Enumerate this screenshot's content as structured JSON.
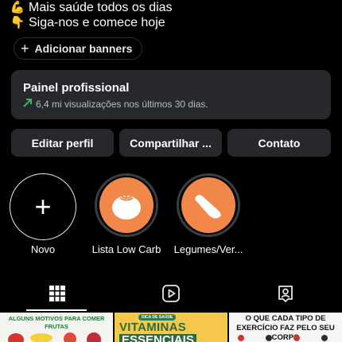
{
  "bio": {
    "line1": {
      "icon": "flexed-biceps-icon",
      "text": "Mais saúde todos os dias"
    },
    "line2": {
      "icon": "pointing-down-icon",
      "text": "Siga-nos e comece hoje"
    }
  },
  "add_banners": {
    "icon": "plus-icon",
    "label": "Adicionar banners"
  },
  "pro_panel": {
    "title": "Painel profissional",
    "trend_icon": "trending-up-arrow-icon",
    "subtitle": "6,4 mi visualizações nos últimos 30 dias."
  },
  "profile_buttons": {
    "edit": "Editar perfil",
    "share": "Compartilhar ...",
    "contact": "Contato"
  },
  "highlights": [
    {
      "label": "Novo",
      "icon": "plus-icon"
    },
    {
      "label": "Lista Low Carb",
      "icon": "tomato-icon"
    },
    {
      "label": "Legumes/Ver...",
      "icon": "cucumber-icon"
    }
  ],
  "tabs": [
    {
      "name": "posts-grid",
      "icon": "grid-icon",
      "active": true
    },
    {
      "name": "reels",
      "icon": "reels-play-icon",
      "active": false
    },
    {
      "name": "tagged",
      "icon": "tagged-person-icon",
      "active": false
    }
  ],
  "thumbnails": [
    {
      "caption": "ALGUNS MOTIVOS PARA COMER FRUTAS"
    },
    {
      "badge": "DICA DE SAÚDE",
      "caption": "VITAMINAS",
      "caption2": "ESSENCIAIS"
    },
    {
      "caption": "O QUE CADA TIPO DE EXERCÍCIO FAZ PELO SEU CORPO"
    }
  ],
  "colors": {
    "background": "#000000",
    "panel": "#26282c",
    "highlight_fill": "#f2874a",
    "trend_green": "#3cc86a"
  }
}
